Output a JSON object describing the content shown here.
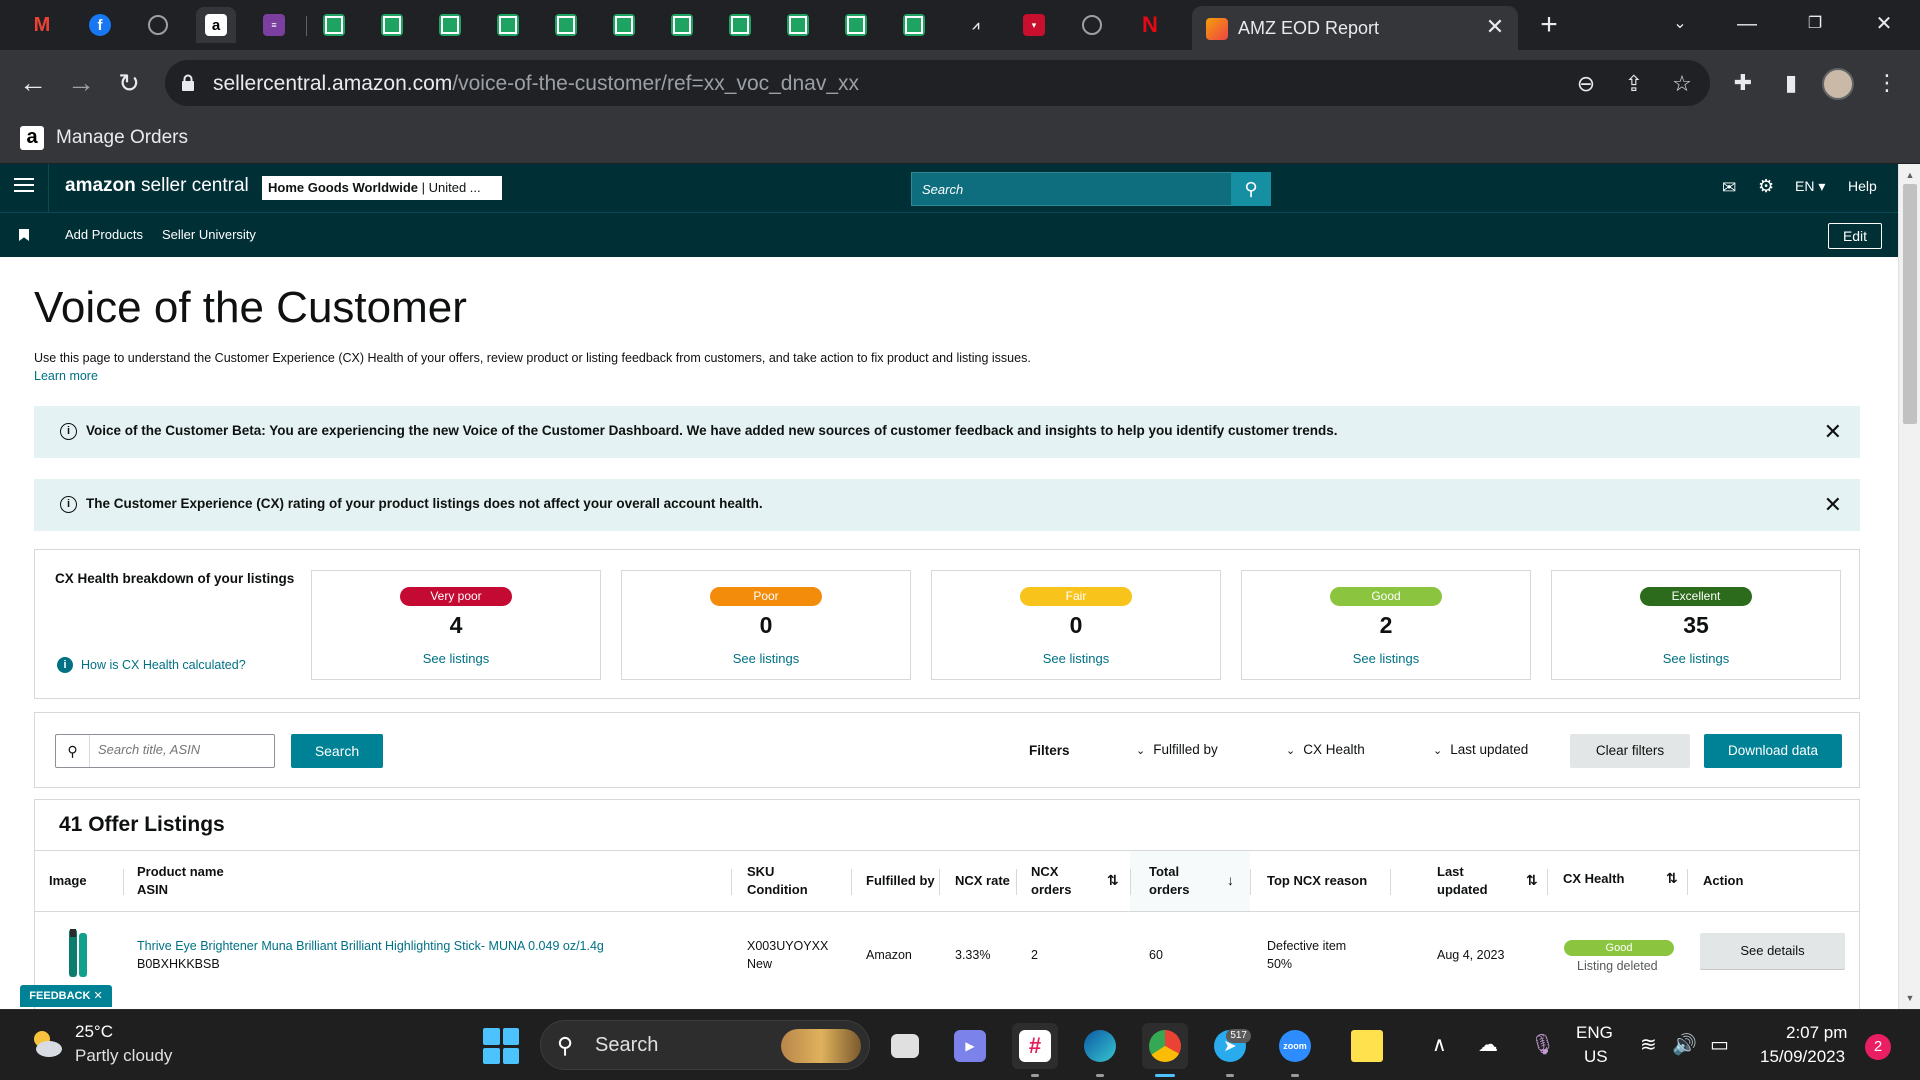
{
  "browser": {
    "tab_title": "AMZ EOD Report",
    "url_host": "sellercentral.amazon.com",
    "url_path": "/voice-of-the-customer/ref=xx_voc_dnav_xx",
    "bookmark_label": "Manage Orders"
  },
  "header": {
    "brand_bold": "amazon",
    "brand_rest": " seller central",
    "store_bold": "Home Goods Worldwide",
    "store_rest": " | United ...",
    "search_placeholder": "Search",
    "language": "EN",
    "help": "Help",
    "nav_items": [
      "Add Products",
      "Seller University"
    ],
    "edit": "Edit"
  },
  "page": {
    "title": "Voice of the Customer",
    "description": "Use this page to understand the Customer Experience (CX) Health of your offers, review product or listing feedback from customers, and take action to fix product and listing issues.",
    "learn_more": "Learn more",
    "alerts": [
      "Voice of the Customer Beta: You are experiencing the new Voice of the Customer Dashboard. We have added new sources of customer feedback and insights to help you identify customer trends.",
      "The Customer Experience (CX) rating of your product listings does not affect your overall account health."
    ]
  },
  "health": {
    "title": "CX Health breakdown of your listings",
    "how_link": "How is CX Health calculated?",
    "see_listings": "See listings",
    "cards": [
      {
        "label": "Very poor",
        "count": "4",
        "color": "#c40a32"
      },
      {
        "label": "Poor",
        "count": "0",
        "color": "#f38b0b"
      },
      {
        "label": "Fair",
        "count": "0",
        "color": "#f8c41c"
      },
      {
        "label": "Good",
        "count": "2",
        "color": "#8bc53f"
      },
      {
        "label": "Excellent",
        "count": "35",
        "color": "#2c6b1b"
      }
    ]
  },
  "filters": {
    "search_placeholder": "Search title, ASIN",
    "search_button": "Search",
    "filters_label": "Filters",
    "dropdowns": [
      "Fulfilled by",
      "CX Health",
      "Last updated"
    ],
    "clear": "Clear filters",
    "download": "Download data"
  },
  "listings": {
    "title": "41 Offer Listings",
    "columns": {
      "image": "Image",
      "product_name": "Product name",
      "asin": "ASIN",
      "sku": "SKU",
      "condition": "Condition",
      "fulfilled_by": "Fulfilled by",
      "ncx_rate": "NCX rate",
      "ncx_orders_1": "NCX",
      "ncx_orders_2": "orders",
      "total_orders_1": "Total",
      "total_orders_2": "orders",
      "top_ncx_reason": "Top NCX reason",
      "last_updated_1": "Last",
      "last_updated_2": "updated",
      "cx_health": "CX Health",
      "action": "Action"
    },
    "rows": [
      {
        "product_name": "Thrive Eye Brightener Muna Brilliant Brilliant Highlighting Stick- MUNA 0.049 oz/1.4g",
        "asin": "B0BXHKKBSB",
        "sku": "X003UYOYXX",
        "condition": "New",
        "fulfilled_by": "Amazon",
        "ncx_rate": "3.33%",
        "ncx_orders": "2",
        "total_orders": "60",
        "top_ncx_reason": "Defective item",
        "top_ncx_pct": "50%",
        "last_updated": "Aug 4, 2023",
        "cx_health": "Good",
        "status": "Listing deleted",
        "action": "See details"
      }
    ]
  },
  "feedback": "FEEDBACK ✕",
  "taskbar": {
    "temperature": "25°C",
    "weather": "Partly cloudy",
    "search": "Search",
    "telegram_badge": "517",
    "zoom_label": "zoom",
    "lang_1": "ENG",
    "lang_2": "US",
    "time": "2:07 pm",
    "date": "15/09/2023",
    "notifications": "2"
  }
}
